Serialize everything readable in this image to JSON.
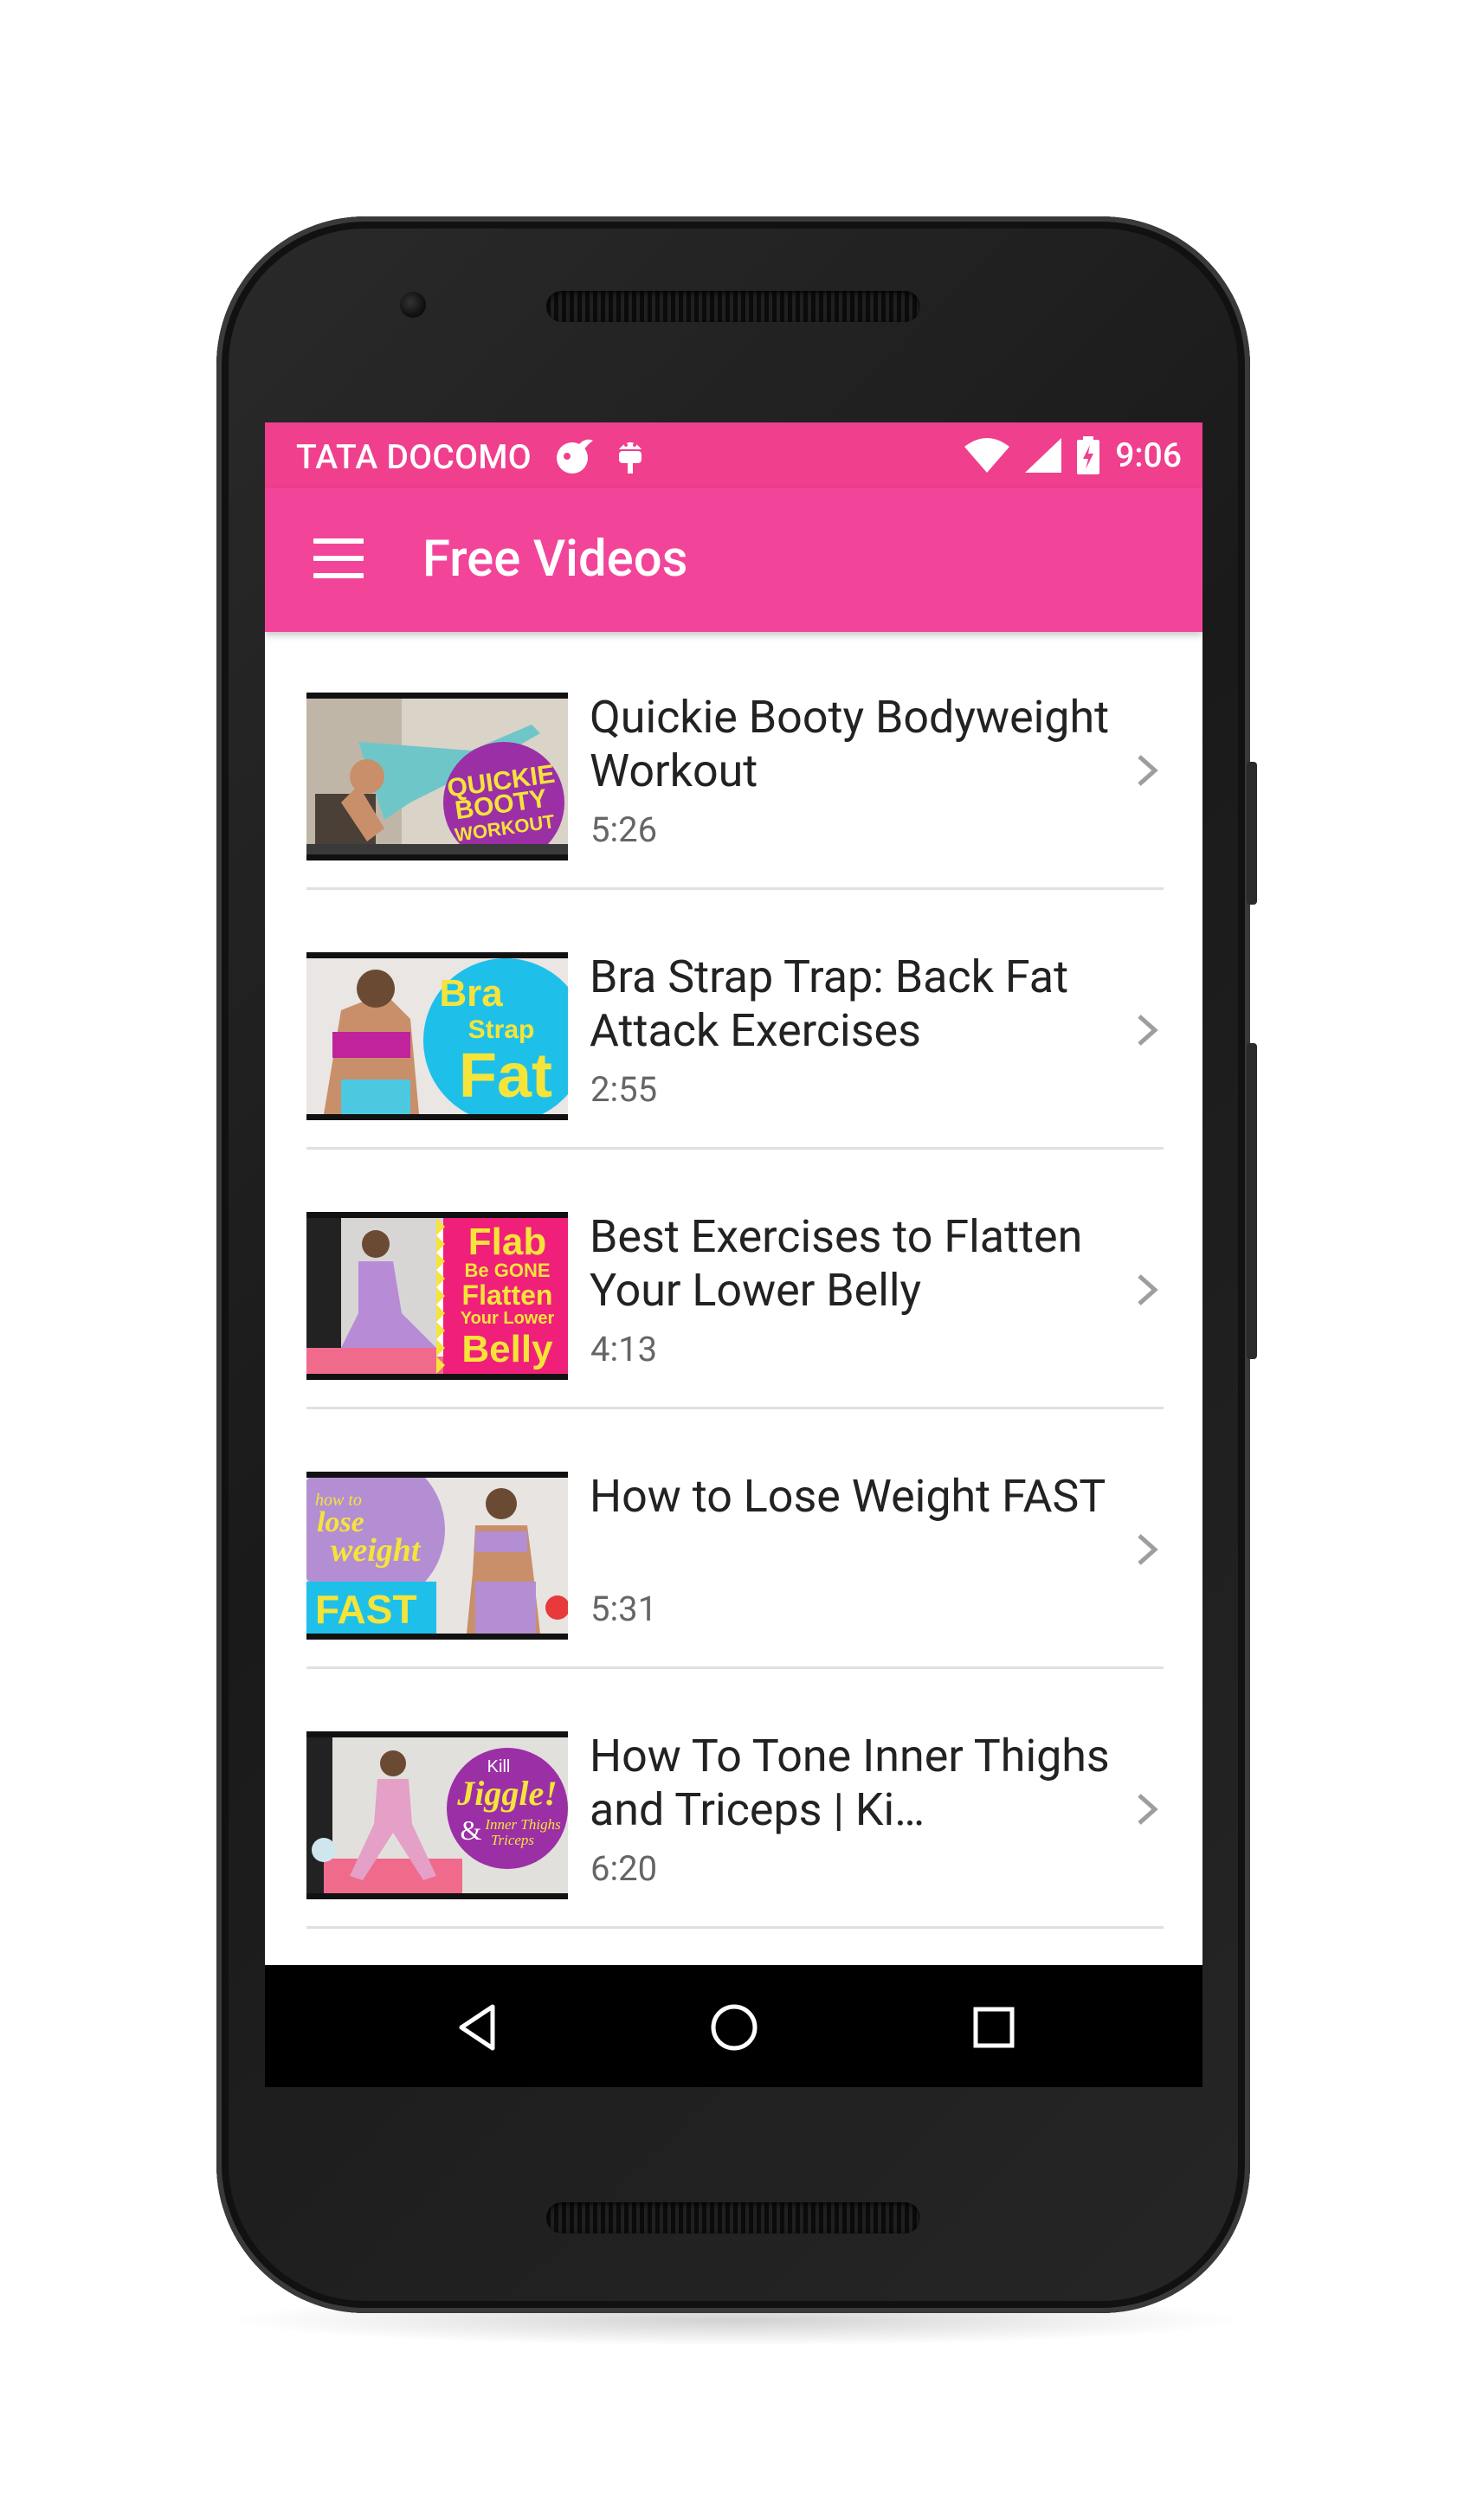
{
  "status_bar": {
    "carrier": "TATA DOCOMO",
    "time": "9:06",
    "icons": [
      "notification-drop-icon",
      "android-debug-icon",
      "wifi-icon",
      "cell-signal-icon",
      "battery-charging-icon"
    ]
  },
  "app_bar": {
    "title": "Free Videos",
    "menu_icon": "hamburger-menu-icon"
  },
  "colors": {
    "accent": "#f2459a",
    "status_bar": "#ef3f8d",
    "title_text": "#222222",
    "duration_text": "#666666"
  },
  "videos": [
    {
      "title": "Quickie Booty Bodyweight Workout",
      "duration": "5:26",
      "thumb_text": [
        "QUICKIE",
        "BOOTY",
        "WORKOUT"
      ]
    },
    {
      "title": "Bra Strap Trap: Back Fat Attack Exercises",
      "duration": "2:55",
      "thumb_text": [
        "Bra",
        "Strap",
        "Fat"
      ]
    },
    {
      "title": "Best Exercises to Flatten Your Lower Belly",
      "duration": "4:13",
      "thumb_text": [
        "Flab",
        "Be GONE",
        "Flatten",
        "Your Lower",
        "Belly"
      ]
    },
    {
      "title": "How to Lose Weight FAST",
      "duration": "5:31",
      "thumb_text": [
        "how to",
        "lose",
        "weight",
        "FAST"
      ]
    },
    {
      "title": "How To Tone Inner Thighs and Triceps | Ki…",
      "duration": "6:20",
      "thumb_text": [
        "Kill",
        "Jiggle!",
        "&",
        "Inner Thighs",
        "Triceps"
      ]
    }
  ],
  "nav_bar": {
    "icons": [
      "back-icon",
      "home-icon",
      "recents-icon"
    ]
  }
}
